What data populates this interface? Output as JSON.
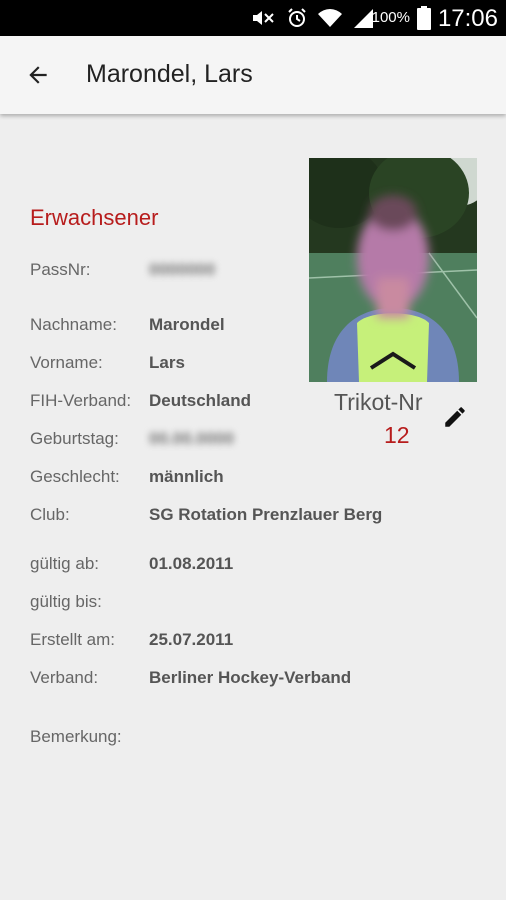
{
  "status_bar": {
    "battery": "100%",
    "time": "17:06",
    "icons": [
      "mute-icon",
      "alarm-icon",
      "wifi-icon",
      "signal-icon",
      "battery-icon"
    ]
  },
  "app_bar": {
    "back_icon": "arrow-back-icon",
    "title": "Marondel, Lars"
  },
  "player": {
    "category": "Erwachsener",
    "fields": {
      "pass_nr": {
        "label": "PassNr:",
        "value": "0000000"
      },
      "nachname": {
        "label": "Nachname:",
        "value": "Marondel"
      },
      "vorname": {
        "label": "Vorname:",
        "value": "Lars"
      },
      "fih_verband": {
        "label": "FIH-Verband:",
        "value": "Deutschland"
      },
      "geburtstag": {
        "label": "Geburtstag:",
        "value": "00.00.0000"
      },
      "geschlecht": {
        "label": "Geschlecht:",
        "value": "männlich"
      },
      "club": {
        "label": "Club:",
        "value": "SG Rotation Prenzlauer Berg"
      },
      "gueltig_ab": {
        "label": "gültig ab:",
        "value": "01.08.2011"
      },
      "gueltig_bis": {
        "label": "gültig bis:",
        "value": ""
      },
      "erstellt_am": {
        "label": "Erstellt am:",
        "value": "25.07.2011"
      },
      "verband": {
        "label": "Verband:",
        "value": "Berliner Hockey-Verband"
      },
      "bemerkung": {
        "label": "Bemerkung:",
        "value": ""
      }
    },
    "trikot": {
      "label": "Trikot-Nr",
      "number": "12",
      "edit_icon": "edit-pencil-icon"
    }
  },
  "colors": {
    "accent": "#b71c1c",
    "background": "#eeeeee",
    "app_bar": "#f5f5f5",
    "status_bar": "#000000"
  }
}
